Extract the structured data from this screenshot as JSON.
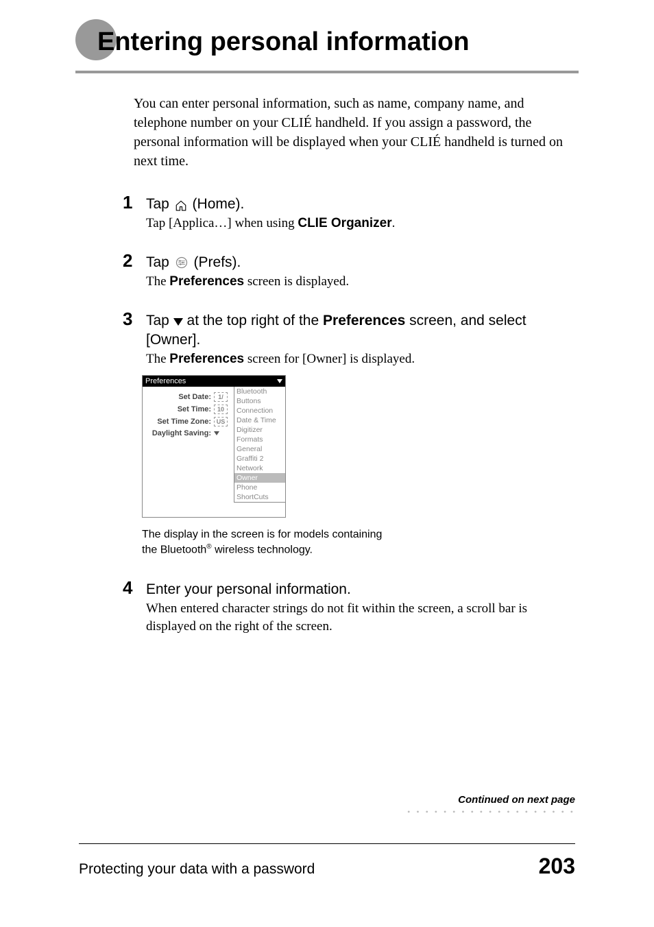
{
  "title": "Entering personal information",
  "intro": "You can enter personal information, such as name, company name, and telephone number on your CLIÉ handheld. If you assign a password, the personal information will be displayed when your CLIÉ handheld is turned on next time.",
  "steps": {
    "s1": {
      "num": "1",
      "main_pre": "Tap ",
      "main_post": " (Home).",
      "sub_pre": "Tap [Applica…] when using ",
      "sub_bold": "CLIE Organizer",
      "sub_post": "."
    },
    "s2": {
      "num": "2",
      "main_pre": "Tap ",
      "main_post": " (Prefs).",
      "sub_pre": "The ",
      "sub_bold": "Preferences",
      "sub_post": " screen is displayed."
    },
    "s3": {
      "num": "3",
      "main_pre": "Tap ",
      "main_mid": " at the top right of the ",
      "main_bold": "Preferences",
      "main_post": " screen, and select [Owner].",
      "sub_pre": "The ",
      "sub_bold": "Preferences",
      "sub_post": " screen for [Owner] is displayed."
    },
    "s4": {
      "num": "4",
      "main": "Enter your personal information.",
      "sub": "When entered character strings do not fit within the screen, a scroll bar is displayed on the right of the screen."
    }
  },
  "screenshot": {
    "title": "Preferences",
    "rows": {
      "date": {
        "label": "Set Date:",
        "val": "1/"
      },
      "time": {
        "label": "Set Time:",
        "val": "10"
      },
      "tz": {
        "label": "Set Time Zone:",
        "val": "US"
      },
      "ds": {
        "label": "Daylight Saving:",
        "val": ""
      }
    },
    "dropdown": {
      "items": [
        "Bluetooth",
        "Buttons",
        "Connection",
        "Date & Time",
        "Digitizer",
        "Formats",
        "General",
        "Graffiti 2",
        "Network",
        "Owner",
        "Phone",
        "ShortCuts"
      ],
      "selected": "Owner"
    },
    "caption_line1": "The display in the screen is for models containing ",
    "caption_line2_pre": "the Bluetooth",
    "caption_line2_sup": "®",
    "caption_line2_post": " wireless technology."
  },
  "continued": "Continued on next page",
  "footer": {
    "text": "Protecting your data with a password",
    "page": "203"
  }
}
